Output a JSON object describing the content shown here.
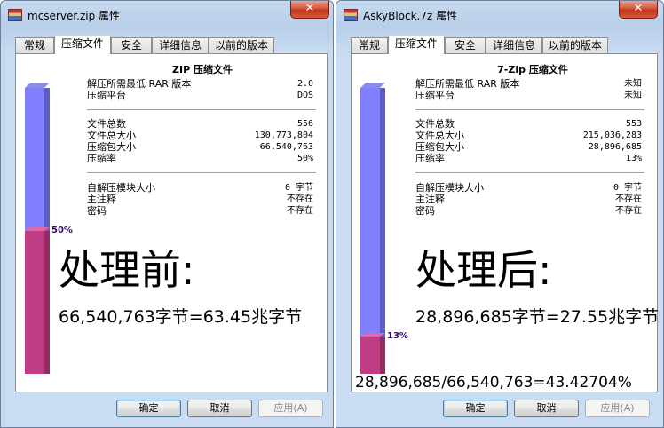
{
  "left": {
    "title": "mcserver.zip 属性",
    "close": "✕",
    "tabs": [
      "常规",
      "压缩文件",
      "安全",
      "详细信息",
      "以前的版本"
    ],
    "panel_title": "ZIP 压缩文件",
    "rows": [
      {
        "label": "解压所需最低 RAR 版本",
        "value": "2.0"
      },
      {
        "label": "压缩平台",
        "value": "DOS"
      },
      {
        "label": "文件总数",
        "value": "556"
      },
      {
        "label": "文件总大小",
        "value": "130,773,804"
      },
      {
        "label": "压缩包大小",
        "value": "66,540,763"
      },
      {
        "label": "压缩率",
        "value": "50%"
      },
      {
        "label": "自解压模块大小",
        "value": "0 字节"
      },
      {
        "label": "主注释",
        "value": "不存在"
      },
      {
        "label": "密码",
        "value": "不存在"
      }
    ],
    "ratio_label": "50%",
    "ratio": 0.5,
    "caption": "处理前:",
    "size_line": "66,540,763字节=63.45兆字节",
    "buttons": {
      "ok": "确定",
      "cancel": "取消",
      "apply": "应用(A)"
    }
  },
  "right": {
    "title": "AskyBlock.7z 属性",
    "close": "✕",
    "tabs": [
      "常规",
      "压缩文件",
      "安全",
      "详细信息",
      "以前的版本"
    ],
    "panel_title": "7-Zip 压缩文件",
    "rows": [
      {
        "label": "解压所需最低 RAR 版本",
        "value": "未知"
      },
      {
        "label": "压缩平台",
        "value": "未知"
      },
      {
        "label": "文件总数",
        "value": "553"
      },
      {
        "label": "文件总大小",
        "value": "215,036,283"
      },
      {
        "label": "压缩包大小",
        "value": "28,896,685"
      },
      {
        "label": "压缩率",
        "value": "13%"
      },
      {
        "label": "自解压模块大小",
        "value": "0 字节"
      },
      {
        "label": "主注释",
        "value": "不存在"
      },
      {
        "label": "密码",
        "value": "不存在"
      }
    ],
    "ratio_label": "13%",
    "ratio": 0.13,
    "caption": "处理后:",
    "size_line": "28,896,685字节=27.55兆字节",
    "ratio_line": "28,896,685/66,540,763=43.42704%",
    "buttons": {
      "ok": "确定",
      "cancel": "取消",
      "apply": "应用(A)"
    }
  },
  "colors": {
    "gauge_empty": "#8080ff",
    "gauge_fill": "#c03c84",
    "percent_text": "#2a0a6a",
    "window_frame": "#c9dcf1",
    "close_button": "#c2341b"
  }
}
